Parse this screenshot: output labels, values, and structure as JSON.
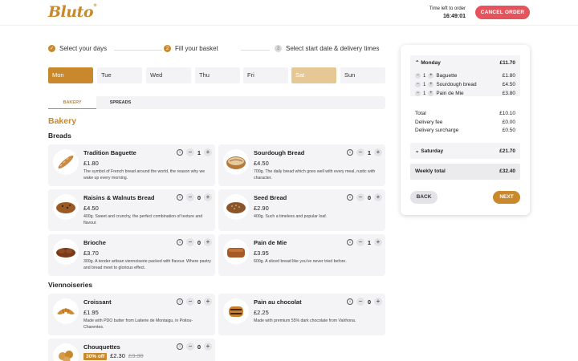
{
  "header": {
    "logo": "Bluto",
    "timer_label": "Time left to order",
    "timer_value": "16:49:01",
    "cancel_label": "CANCEL ORDER"
  },
  "steps": [
    {
      "num": "✓",
      "label": "Select your days",
      "state": "done"
    },
    {
      "num": "2",
      "label": "Fill your basket",
      "state": "active"
    },
    {
      "num": "3",
      "label": "Select start date & delivery times",
      "state": "pending"
    }
  ],
  "days": [
    {
      "label": "Mon",
      "state": "selected"
    },
    {
      "label": "Tue",
      "state": "normal"
    },
    {
      "label": "Wed",
      "state": "normal"
    },
    {
      "label": "Thu",
      "state": "normal"
    },
    {
      "label": "Fri",
      "state": "normal"
    },
    {
      "label": "Sat",
      "state": "light"
    },
    {
      "label": "Sun",
      "state": "normal"
    }
  ],
  "category_tabs": [
    "BAKERY",
    "SPREADS"
  ],
  "section_title": "Bakery",
  "groups": {
    "breads": "Breads",
    "viennoiseries": "Viennoiseries"
  },
  "products": [
    {
      "name": "Tradition Baguette",
      "price": "£1.80",
      "qty": "1",
      "desc": "The symbol of French bread around the world, the reason why we wake up every morning."
    },
    {
      "name": "Sourdough Bread",
      "price": "£4.50",
      "qty": "1",
      "desc": "700g. The daily bread which goes well with every meal, rustic with character."
    },
    {
      "name": "Raisins & Walnuts Bread",
      "price": "£4.50",
      "qty": "0",
      "desc": "400g. Sweet and crunchy, the perfect combination of texture and flavour."
    },
    {
      "name": "Seed Bread",
      "price": "£2.90",
      "qty": "0",
      "desc": "400g. Such a timeless and popular loaf."
    },
    {
      "name": "Brioche",
      "price": "£3.70",
      "qty": "0",
      "desc": "300g. A tender artisan viennoiserie packed with flavour. Where pastry and bread meet to glorious effect."
    },
    {
      "name": "Pain de Mie",
      "price": "£3.95",
      "qty": "1",
      "desc": "600g. A sliced bread like you've never tried before."
    },
    {
      "name": "Croissant",
      "price": "£1.95",
      "qty": "0",
      "desc": "Made with PDO butter from Laiterie de Montaigu, in Poitou-Charentes."
    },
    {
      "name": "Pain au chocolat",
      "price": "£2.25",
      "qty": "0",
      "desc": "Made with premium 55% dark chocolate from Valrhona."
    },
    {
      "name": "Chouquettes",
      "price": "£2.30",
      "qty": "0",
      "badge": "30% off",
      "old_price": "£3.30",
      "desc": ""
    }
  ],
  "summary": {
    "monday_label": "Monday",
    "monday_total": "£11.70",
    "items": [
      {
        "qty": "1",
        "name": "Baguette",
        "price": "£1.80"
      },
      {
        "qty": "1",
        "name": "Sourdough bread",
        "price": "£4.50"
      },
      {
        "qty": "1",
        "name": "Pain de Mie",
        "price": "£3.80"
      }
    ],
    "total_label": "Total",
    "total_value": "£10.10",
    "delivery_label": "Delivery fee",
    "delivery_value": "£0.00",
    "surcharge_label": "Delivery surcharge",
    "surcharge_value": "£0.50",
    "saturday_label": "Saturday",
    "saturday_total": "£21.70",
    "weekly_label": "Weekly total",
    "weekly_value": "£32.40",
    "back_label": "BACK",
    "next_label": "NEXT"
  },
  "colors": {
    "accent": "#c8882b",
    "danger": "#e5545c",
    "card": "#f4f4f6"
  }
}
